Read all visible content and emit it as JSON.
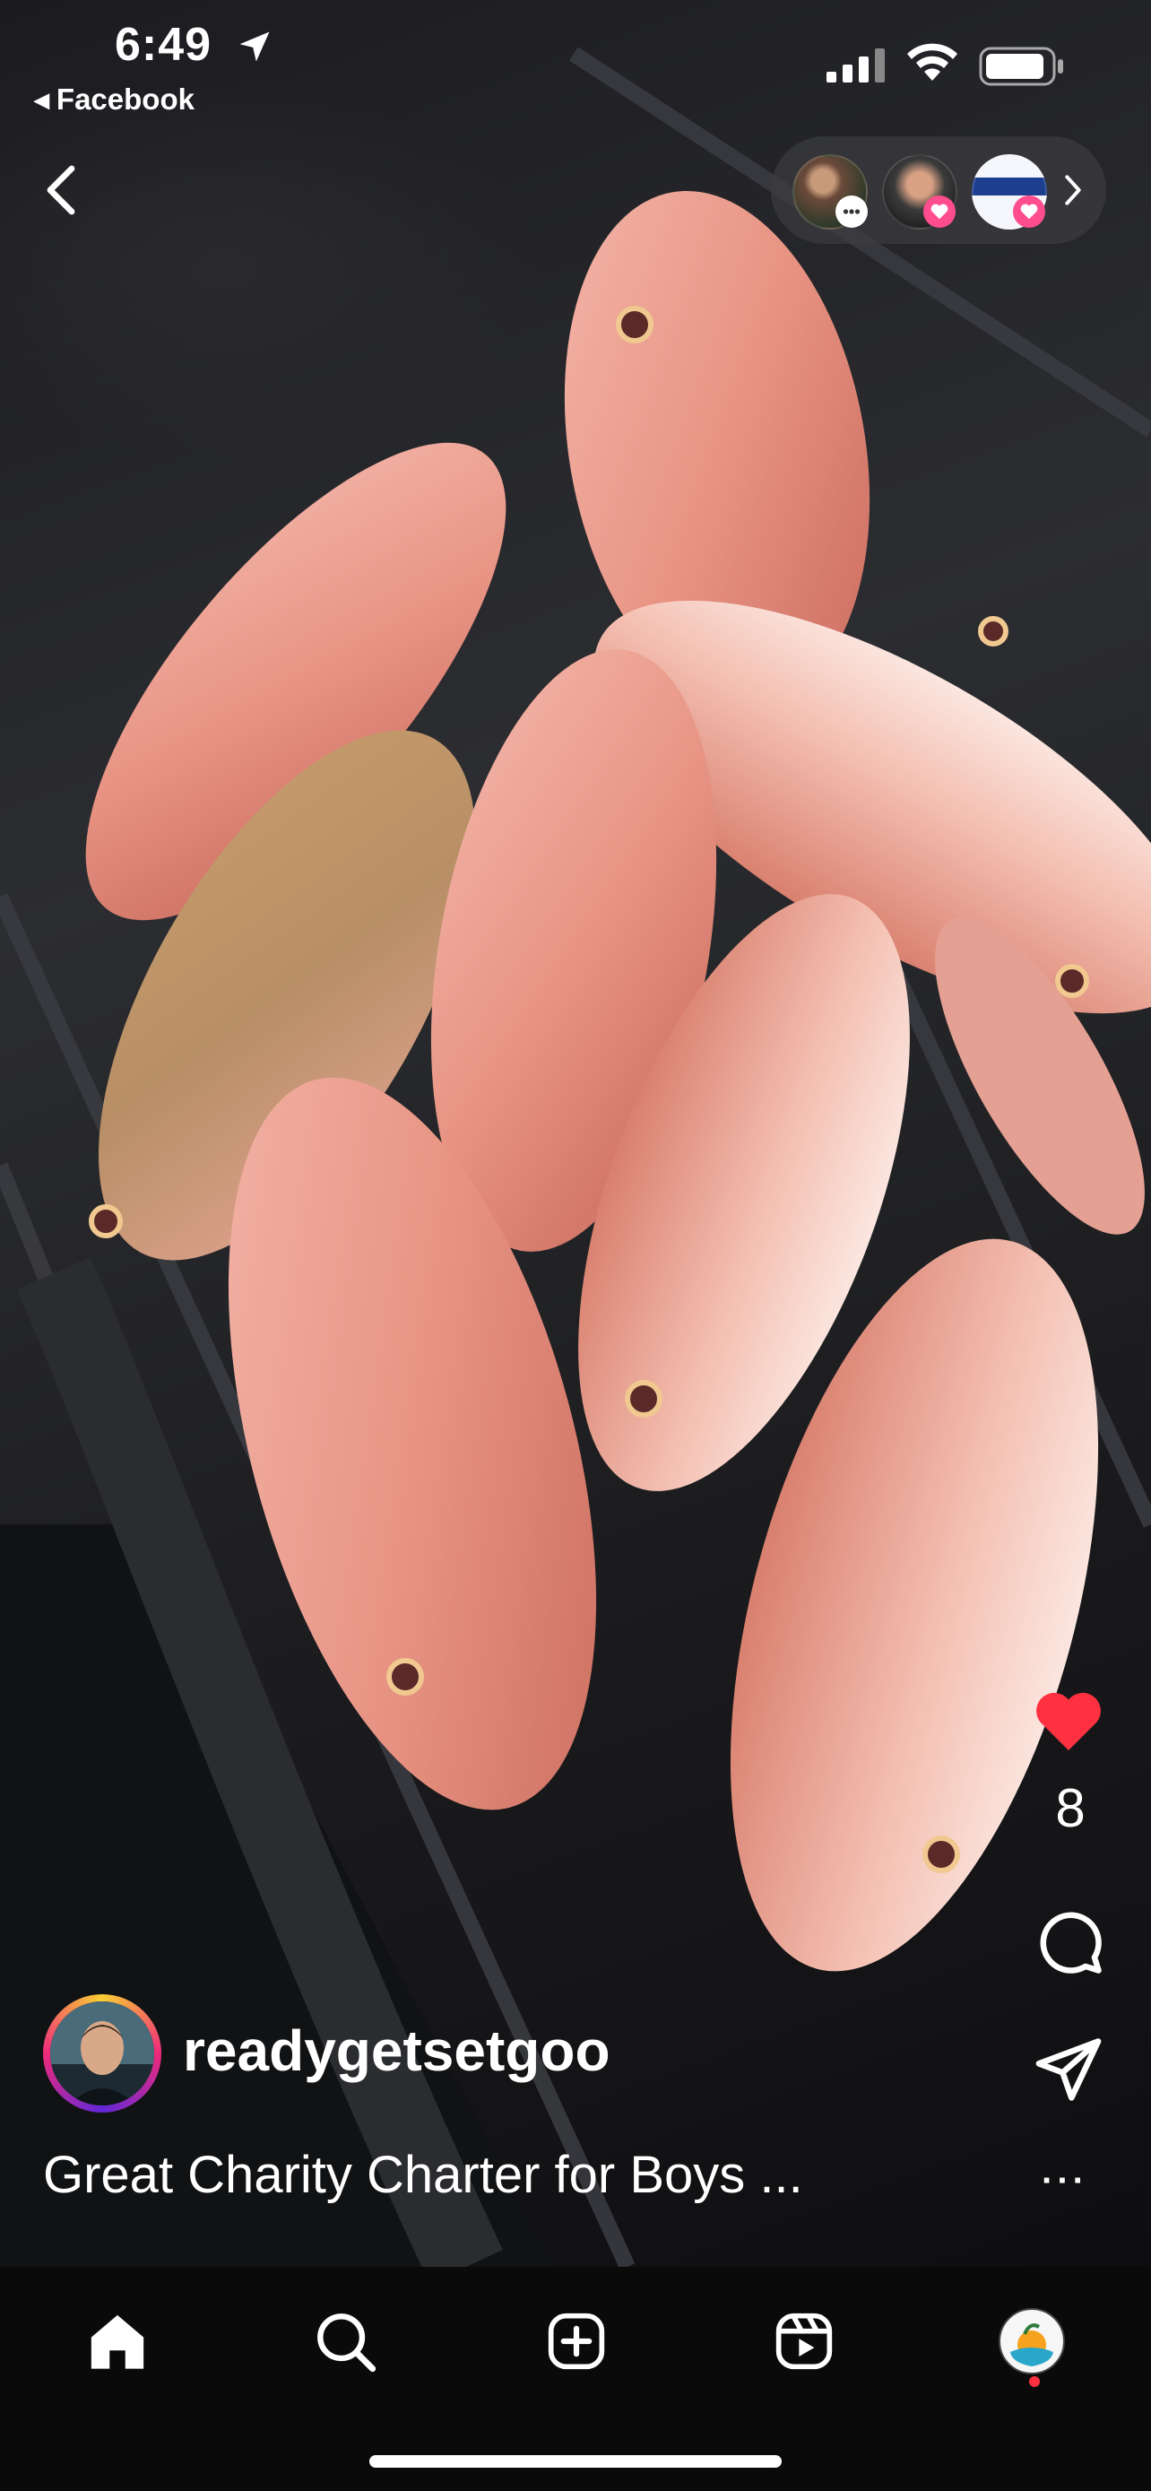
{
  "status_bar": {
    "time": "6:49",
    "back_app_label": "Facebook",
    "location_icon": "location-arrow-icon",
    "signal_icon": "cellular-signal-icon",
    "wifi_icon": "wifi-icon",
    "battery_icon": "battery-icon"
  },
  "top_nav": {
    "back_icon": "chevron-left-icon",
    "story_tray": {
      "avatars": [
        {
          "name": "story-avatar-1",
          "badge": "chat-bubble-icon"
        },
        {
          "name": "story-avatar-2",
          "badge": "heart-icon"
        },
        {
          "name": "story-avatar-3",
          "badge": "heart-icon"
        }
      ],
      "expand_icon": "chevron-right-icon"
    }
  },
  "post": {
    "media_description_icon": "fish-photo",
    "author": "readygetsetgoo",
    "caption": "Great Charity Charter for Boys ...",
    "likes": "8",
    "liked": true
  },
  "actions": {
    "like_icon": "heart-icon",
    "comment_icon": "comment-icon",
    "share_icon": "paper-plane-icon",
    "more_icon": "more-horizontal-icon",
    "more_label": "···"
  },
  "tabbar": {
    "tabs": [
      {
        "name": "home",
        "icon": "home-icon",
        "active": true
      },
      {
        "name": "search",
        "icon": "search-icon"
      },
      {
        "name": "create",
        "icon": "plus-square-icon"
      },
      {
        "name": "reels",
        "icon": "reels-icon"
      },
      {
        "name": "profile",
        "icon": "profile-avatar"
      }
    ]
  },
  "colors": {
    "like_red": "#ff3040",
    "tabbar_bg": "#0a0a0a",
    "notification_dot": "#ff3040",
    "badge_pink": "#ff4d8d"
  }
}
